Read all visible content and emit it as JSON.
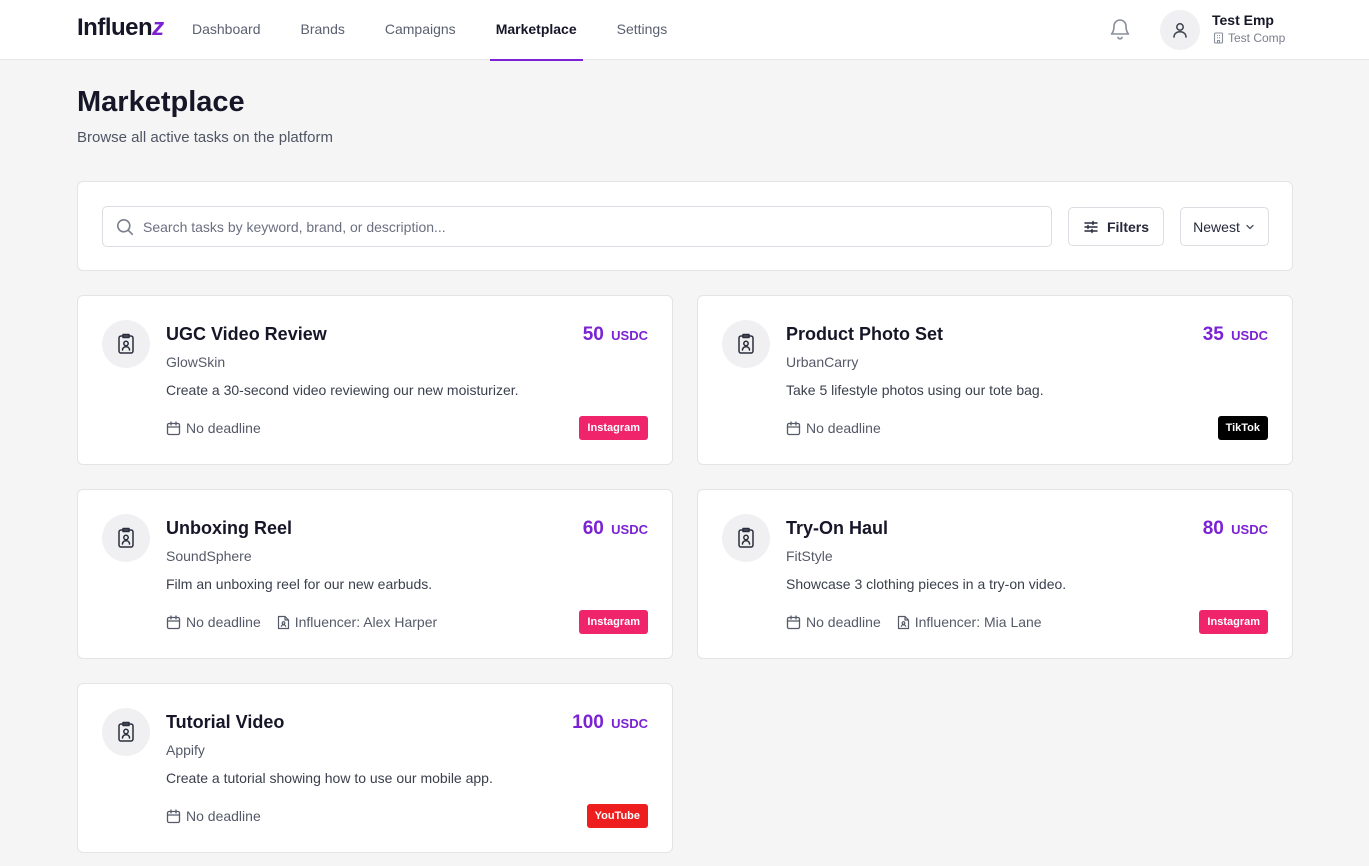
{
  "brand": {
    "logo_main": "Influen",
    "logo_accent": "z",
    "accent_color": "#7b22d4"
  },
  "nav": {
    "items": [
      "Dashboard",
      "Brands",
      "Campaigns",
      "Marketplace",
      "Settings"
    ],
    "active": "Marketplace"
  },
  "user": {
    "name": "Test Emp",
    "company": "Test Comp"
  },
  "page": {
    "title": "Marketplace",
    "subtitle": "Browse all active tasks on the platform"
  },
  "search": {
    "placeholder": "Search tasks by keyword, brand, or description...",
    "value": "",
    "filters_label": "Filters",
    "sort_label": "Newest"
  },
  "platform_colors": {
    "Instagram": "#f0246a",
    "TikTok": "#000000",
    "YouTube": "#ee1e1e"
  },
  "tasks": [
    {
      "title": "UGC Video Review",
      "brand": "GlowSkin",
      "description": "Create a 30-second video reviewing our new moisturizer.",
      "price": "50",
      "unit": "USDC",
      "deadline": "No deadline",
      "influencer": "",
      "platform": "Instagram"
    },
    {
      "title": "Product Photo Set",
      "brand": "UrbanCarry",
      "description": "Take 5 lifestyle photos using our tote bag.",
      "price": "35",
      "unit": "USDC",
      "deadline": "No deadline",
      "influencer": "",
      "platform": "TikTok"
    },
    {
      "title": "Unboxing Reel",
      "brand": "SoundSphere",
      "description": "Film an unboxing reel for our new earbuds.",
      "price": "60",
      "unit": "USDC",
      "deadline": "No deadline",
      "influencer": "Influencer: Alex Harper",
      "platform": "Instagram"
    },
    {
      "title": "Try-On Haul",
      "brand": "FitStyle",
      "description": "Showcase 3 clothing pieces in a try-on video.",
      "price": "80",
      "unit": "USDC",
      "deadline": "No deadline",
      "influencer": "Influencer: Mia Lane",
      "platform": "Instagram"
    },
    {
      "title": "Tutorial Video",
      "brand": "Appify",
      "description": "Create a tutorial showing how to use our mobile app.",
      "price": "100",
      "unit": "USDC",
      "deadline": "No deadline",
      "influencer": "",
      "platform": "YouTube"
    }
  ]
}
